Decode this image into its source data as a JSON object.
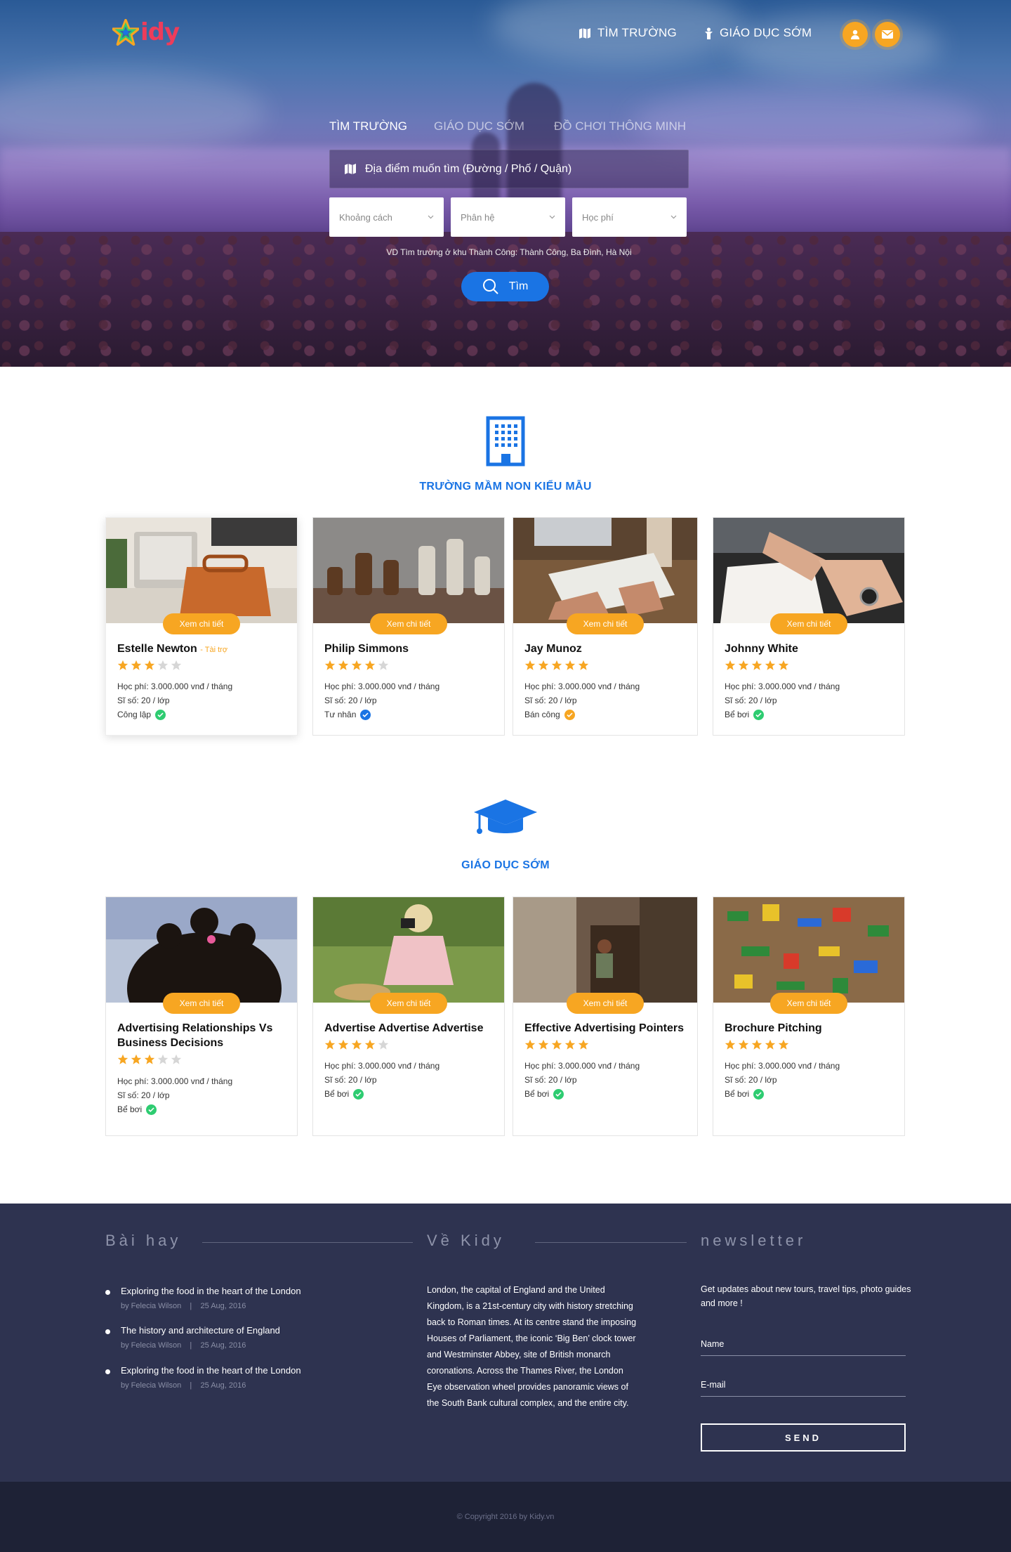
{
  "brand": {
    "logo_text": "idy",
    "accent": "#1a74e4",
    "orange": "#f7a622"
  },
  "nav": {
    "find_school": "TÌM TRƯỜNG",
    "early_education": "GIÁO DỤC SỚM"
  },
  "search": {
    "tabs": [
      "TÌM TRƯỜNG",
      "GIÁO DỤC SỚM",
      "ĐỒ CHƠI THÔNG MINH"
    ],
    "location_placeholder": "Địa điểm muốn tìm (Đường / Phố / Quận)",
    "filters": [
      "Khoảng cách",
      "Phân hệ",
      "Học phí"
    ],
    "hint": "VD Tìm trường ở khu Thành Công: Thành Công, Ba Đình, Hà Nội",
    "button": "Tìm"
  },
  "section_schools": {
    "title": "TRƯỜNG MẦM NON KIỂU MẪU",
    "cards": [
      {
        "name": "Estelle Newton",
        "sponsor": "- Tài trợ",
        "rating": 3,
        "fee": "Học phí: 3.000.000 vnđ / tháng",
        "size": "Sĩ số: 20 / lớp",
        "type": "Công lập",
        "check_color": "#2ecc71",
        "detail": "Xem chi tiết"
      },
      {
        "name": "Philip Simmons",
        "sponsor": "",
        "rating": 4,
        "fee": "Học phí: 3.000.000 vnđ / tháng",
        "size": "Sĩ số: 20 / lớp",
        "type": "Tư nhân",
        "check_color": "#1a74e4",
        "detail": "Xem chi tiết"
      },
      {
        "name": "Jay Munoz",
        "sponsor": "",
        "rating": 5,
        "fee": "Học phí: 3.000.000 vnđ / tháng",
        "size": "Sĩ số: 20 / lớp",
        "type": "Bán công",
        "check_color": "#f7a622",
        "detail": "Xem chi tiết"
      },
      {
        "name": "Johnny White",
        "sponsor": "",
        "rating": 5,
        "fee": "Học phí: 3.000.000 vnđ / tháng",
        "size": "Sĩ số: 20 / lớp",
        "type": "Bể bơi",
        "check_color": "#2ecc71",
        "detail": "Xem chi tiết"
      }
    ]
  },
  "section_early": {
    "title": "GIÁO DỤC SỚM",
    "cards": [
      {
        "name": "Advertising Relationships Vs Business Decisions",
        "rating": 3,
        "fee": "Học phí: 3.000.000 vnđ / tháng",
        "size": "Sĩ số: 20 / lớp",
        "type": "Bể bơi",
        "check_color": "#2ecc71",
        "detail": "Xem chi tiết"
      },
      {
        "name": "Advertise Advertise Advertise",
        "rating": 4,
        "fee": "Học phí: 3.000.000 vnđ / tháng",
        "size": "Sĩ số: 20 / lớp",
        "type": "Bể bơi",
        "check_color": "#2ecc71",
        "detail": "Xem chi tiết"
      },
      {
        "name": "Effective Advertising Pointers",
        "rating": 5,
        "fee": "Học phí: 3.000.000 vnđ / tháng",
        "size": "Sĩ số: 20 / lớp",
        "type": "Bể bơi",
        "check_color": "#2ecc71",
        "detail": "Xem chi tiết"
      },
      {
        "name": "Brochure Pitching",
        "rating": 5,
        "fee": "Học phí: 3.000.000 vnđ / tháng",
        "size": "Sĩ số: 20 / lớp",
        "type": "Bể bơi",
        "check_color": "#2ecc71",
        "detail": "Xem chi tiết"
      }
    ]
  },
  "footer": {
    "posts_heading": "Bài hay",
    "posts": [
      {
        "title": "Exploring the food in the heart of the London",
        "author": "by Felecia Wilson",
        "date": "25 Aug, 2016"
      },
      {
        "title": "The history and architecture of England",
        "author": "by Felecia Wilson",
        "date": "25 Aug, 2016"
      },
      {
        "title": "Exploring the food in the heart of the London",
        "author": "by Felecia Wilson",
        "date": "25 Aug, 2016"
      }
    ],
    "about_heading": "Về Kidy",
    "about_text": "London, the capital of England and the United Kingdom, is a 21st-century city with history stretching back to Roman times. At its centre stand the imposing Houses of Parliament, the iconic ‘Big Ben’ clock tower and Westminster Abbey, site of British monarch coronations. Across the Thames River, the London Eye observation wheel provides panoramic views of the South Bank cultural complex, and the entire city.",
    "newsletter_heading": "newsletter",
    "newsletter_text": "Get updates about new tours, travel tips, photo guides and more !",
    "name_label": "Name",
    "email_label": "E-mail",
    "send_label": "SEND",
    "copyright": "© Copyright 2016  by Kidy.vn"
  }
}
